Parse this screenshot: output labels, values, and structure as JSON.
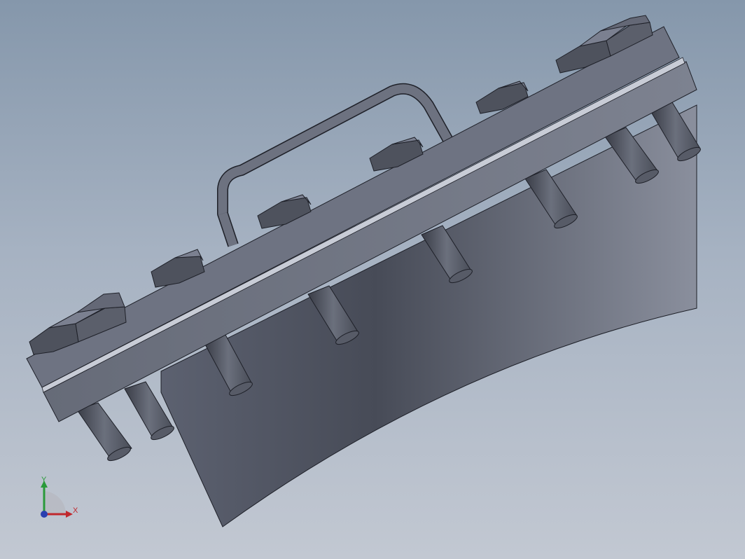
{
  "viewport": {
    "model": "flange-assembly",
    "background_top": "#8597ab",
    "background_bottom": "#c2c8d2",
    "part_color": "#5a5f6b"
  },
  "triad": {
    "x_label": "X",
    "y_label": "Y",
    "x_color": "#c0282d",
    "y_color": "#2a9a3a",
    "z_color": "#2a3fb0"
  }
}
